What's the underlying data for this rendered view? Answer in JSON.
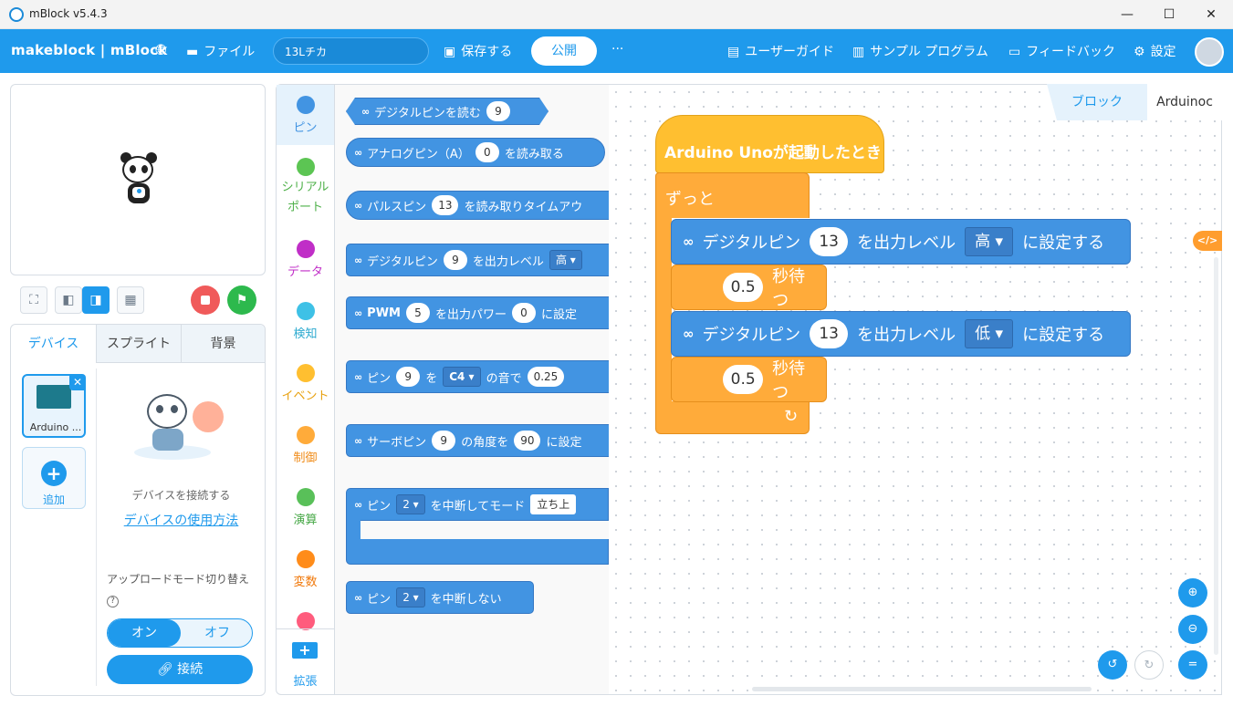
{
  "window": {
    "title": "mBlock v5.4.3",
    "minimize": "—",
    "maximize": "☐",
    "close": "✕"
  },
  "menubar": {
    "brand": "makeblock | mBlock",
    "file": "ファイル",
    "project_name": "13Lチカ",
    "save": "保存する",
    "publish": "公開",
    "more": "···",
    "user_guide": "ユーザーガイド",
    "samples": "サンプル プログラム",
    "feedback": "フィードバック",
    "settings": "設定"
  },
  "device_panel": {
    "tabs": [
      "デバイス",
      "スプライト",
      "背景"
    ],
    "device_name": "Arduino ...",
    "add": "追加",
    "connect_prompt": "デバイスを接続する",
    "how_to_link": "デバイスの使用方法",
    "upload_mode": "アップロードモード切り替え",
    "help": "?",
    "on": "オン",
    "off": "オフ",
    "connect": "接続"
  },
  "categories": [
    {
      "label": "ピン",
      "color": "#4294e2"
    },
    {
      "label": "シリアル\nポート",
      "color": "#5cc553"
    },
    {
      "label": "データ",
      "color": "#c02ec7"
    },
    {
      "label": "検知",
      "color": "#3ec1e6"
    },
    {
      "label": "イベント",
      "color": "#ffbf30"
    },
    {
      "label": "制御",
      "color": "#ffab3a"
    },
    {
      "label": "演算",
      "color": "#59c059"
    },
    {
      "label": "変数",
      "color": "#ff8c1a"
    },
    {
      "label": "",
      "color": "#ff5c7d"
    }
  ],
  "extension": {
    "icon": "+",
    "label": "拡張"
  },
  "palette": {
    "b1": {
      "text": "デジタルピンを読む",
      "v1": "9"
    },
    "b2": {
      "t1": "アナログピン（A）",
      "v1": "0",
      "t2": "を読み取る"
    },
    "b3": {
      "t1": "パルスピン",
      "v1": "13",
      "t2": "を読み取りタイムアウ"
    },
    "b4": {
      "t1": "デジタルピン",
      "v1": "9",
      "t2": "を出力レベル",
      "v2": "高 ▾"
    },
    "b5": {
      "t1": "PWM",
      "v1": "5",
      "t2": "を出力パワー",
      "v2": "0",
      "t3": "に設定"
    },
    "b6": {
      "t1": "ピン",
      "v1": "9",
      "t2": "を",
      "v2": "C4 ▾",
      "t3": "の音で",
      "v3": "0.25"
    },
    "b7": {
      "t1": "サーボピン",
      "v1": "9",
      "t2": "の角度を",
      "v2": "90",
      "t3": "に設定"
    },
    "b8": {
      "t1": "ピン",
      "v1": "2 ▾",
      "t2": "を中断してモード",
      "v2": "立ち上"
    },
    "b9": {
      "t1": "ピン",
      "v1": "2 ▾",
      "t2": "を中断しない"
    }
  },
  "workspace": {
    "tab_block": "ブロック",
    "tab_code": "Arduinoc",
    "hat": "Arduino Unoが起動したとき",
    "forever": "ずっと",
    "s1": {
      "t1": "デジタルピン",
      "pin": "13",
      "t2": "を出力レベル",
      "level": "高 ▾",
      "t3": "に設定する"
    },
    "w1": {
      "value": "0.5",
      "label": "秒待つ"
    },
    "s2": {
      "t1": "デジタルピン",
      "pin": "13",
      "t2": "を出力レベル",
      "level": "低 ▾",
      "t3": "に設定する"
    },
    "w2": {
      "value": "0.5",
      "label": "秒待つ"
    },
    "loop_arrow": "↻",
    "code_toggle": "</>"
  }
}
